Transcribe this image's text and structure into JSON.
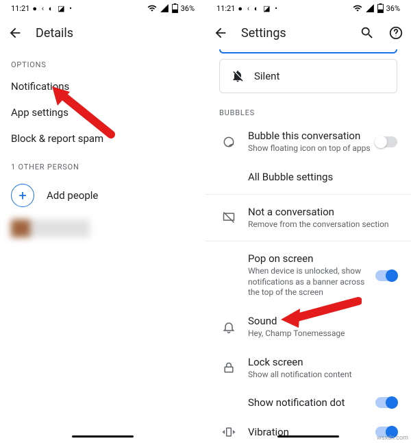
{
  "status": {
    "time": "11:21",
    "battery": "36%"
  },
  "left": {
    "title": "Details",
    "options_label": "OPTIONS",
    "notifications": "Notifications",
    "app_settings": "App settings",
    "block_report": "Block & report spam",
    "other_person_label": "1 OTHER PERSON",
    "add_people": "Add people"
  },
  "right": {
    "title": "Settings",
    "silent": "Silent",
    "bubbles_label": "BUBBLES",
    "bubble_title": "Bubble this conversation",
    "bubble_sub": "Show floating icon on top of apps",
    "all_bubble": "All Bubble settings",
    "not_conv_title": "Not a conversation",
    "not_conv_sub": "Remove from the conversation section",
    "pop_title": "Pop on screen",
    "pop_sub": "When device is unlocked, show notifications as a banner across the top of the screen",
    "sound_title": "Sound",
    "sound_sub": "Hey, Champ Tonemessage",
    "lock_title": "Lock screen",
    "lock_sub": "Show all notification content",
    "dot": "Show notification dot",
    "vibration": "Vibration"
  },
  "watermark": "wsxdn.com"
}
